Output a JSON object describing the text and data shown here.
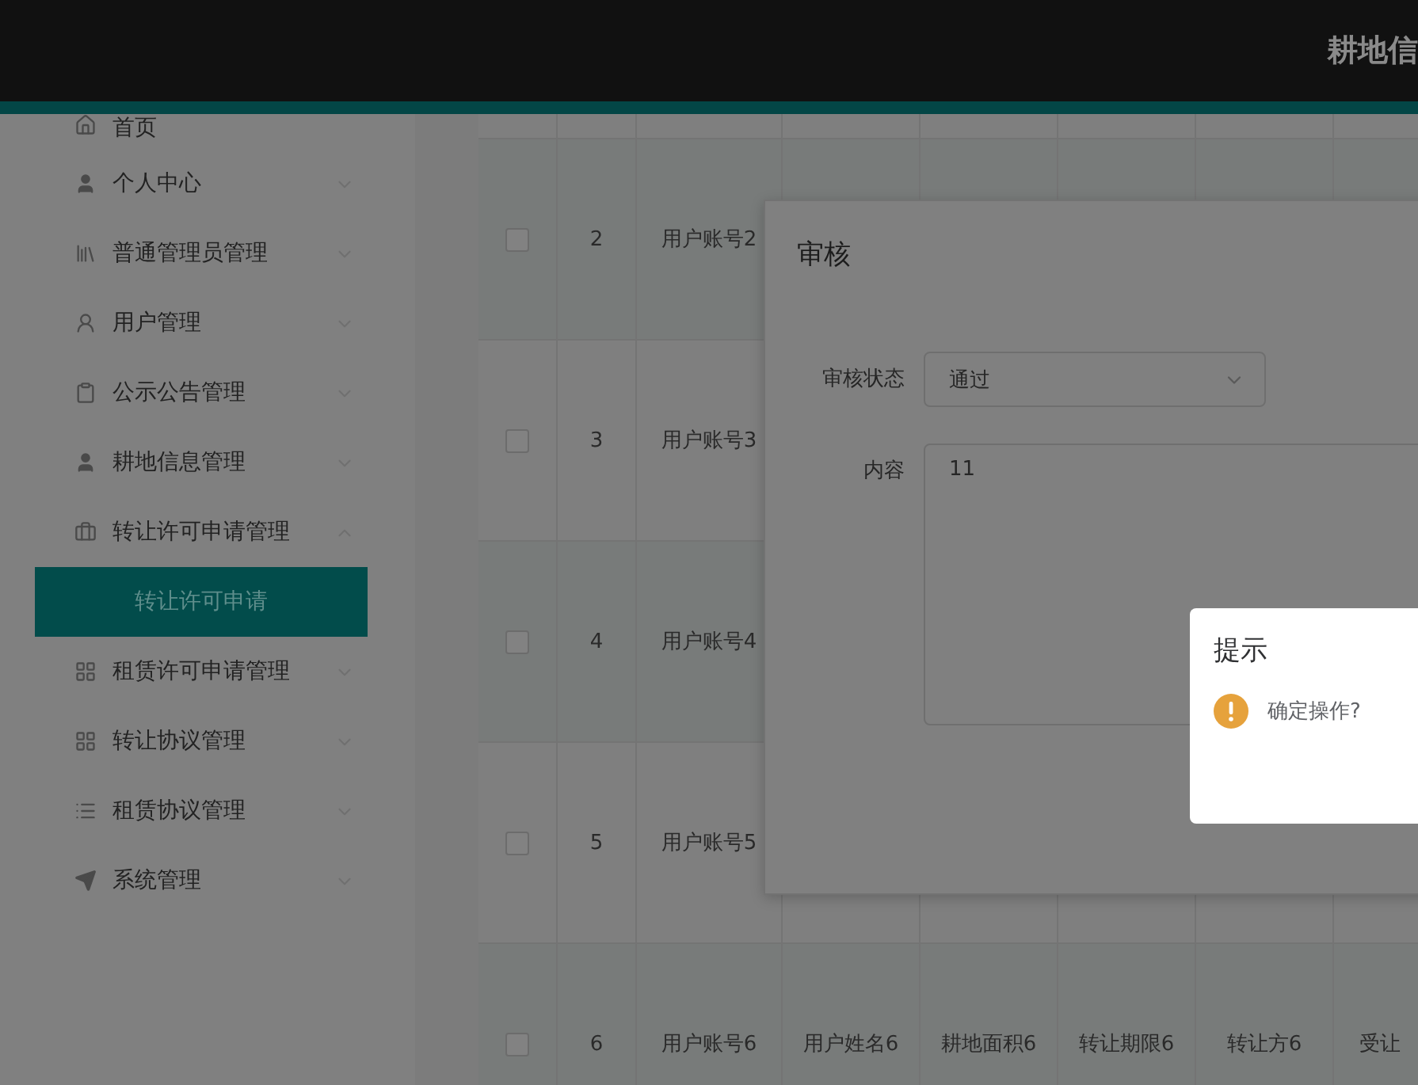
{
  "header": {
    "title": "耕地信"
  },
  "sidebar": {
    "items": [
      {
        "label": "首页",
        "kind": "link"
      },
      {
        "label": "个人中心",
        "kind": "menu",
        "expanded": false
      },
      {
        "label": "普通管理员管理",
        "kind": "menu",
        "expanded": false
      },
      {
        "label": "用户管理",
        "kind": "menu",
        "expanded": false
      },
      {
        "label": "公示公告管理",
        "kind": "menu",
        "expanded": false
      },
      {
        "label": "耕地信息管理",
        "kind": "menu",
        "expanded": false
      },
      {
        "label": "转让许可申请管理",
        "kind": "menu",
        "expanded": true,
        "children": [
          {
            "label": "转让许可申请",
            "selected": true
          }
        ]
      },
      {
        "label": "租赁许可申请管理",
        "kind": "menu",
        "expanded": false
      },
      {
        "label": "转让协议管理",
        "kind": "menu",
        "expanded": false
      },
      {
        "label": "租赁协议管理",
        "kind": "menu",
        "expanded": false
      },
      {
        "label": "系统管理",
        "kind": "menu",
        "expanded": false
      }
    ]
  },
  "table": {
    "rows": [
      {
        "index": "2",
        "checked": false,
        "cells": [
          "用户账号2"
        ]
      },
      {
        "index": "3",
        "checked": false,
        "cells": [
          "用户账号3"
        ]
      },
      {
        "index": "4",
        "checked": false,
        "cells": [
          "用户账号4"
        ]
      },
      {
        "index": "5",
        "checked": false,
        "cells": [
          "用户账号5"
        ]
      },
      {
        "index": "6",
        "checked": false,
        "cells": [
          "用户账号6",
          "用户姓名6",
          "耕地面积6",
          "转让期限6",
          "转让方6",
          "受让"
        ]
      }
    ]
  },
  "dialog": {
    "title": "审核",
    "fields": [
      {
        "kind": "select",
        "label": "审核状态",
        "value": "通过"
      },
      {
        "kind": "textarea",
        "label": "内容",
        "value": "11"
      }
    ]
  },
  "message_box": {
    "title": "提示",
    "kind": "warning",
    "message": "确定操作?"
  }
}
